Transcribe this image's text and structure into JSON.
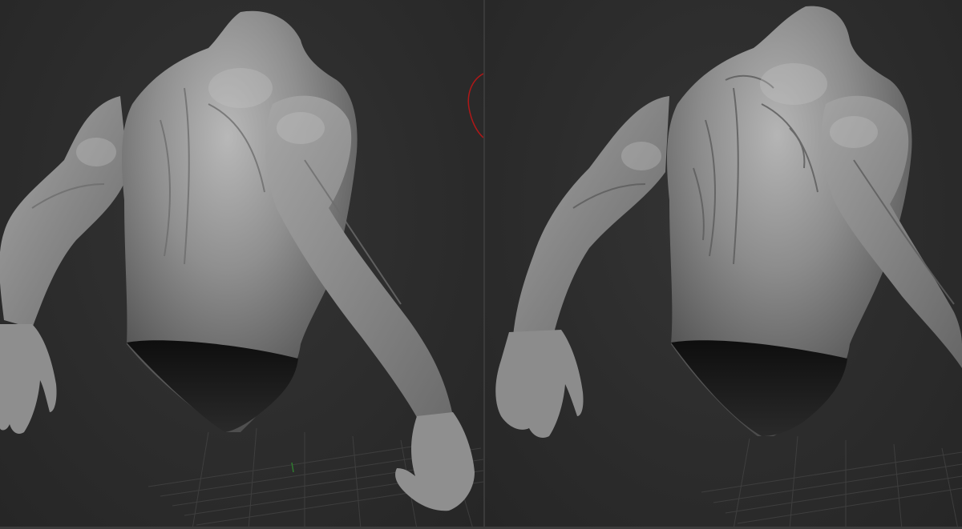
{
  "app": {
    "background_color": "#2b2b2b",
    "mesh_color": "#9a9a9a",
    "grid_color": "#4a4a4a",
    "gizmo_color": "#b01818"
  },
  "viewports": [
    {
      "id": "left",
      "view": "back",
      "model": "muscular-torso-sculpt"
    },
    {
      "id": "right",
      "view": "back",
      "model": "muscular-torso-sculpt-detailed"
    }
  ],
  "icons": {
    "rotate_gizmo": "rotation-arc-icon"
  }
}
